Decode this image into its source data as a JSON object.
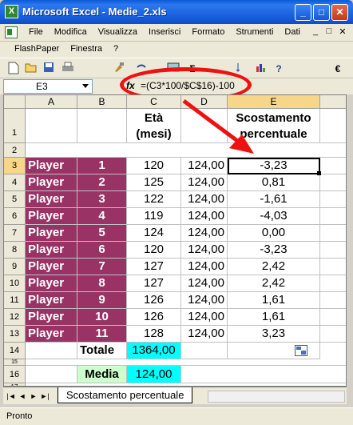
{
  "window": {
    "title": "Microsoft Excel - Medie_2.xls",
    "app_icon_letter": "X",
    "min_glyph": "_",
    "max_glyph": "□",
    "close_glyph": "✕"
  },
  "menu": {
    "items": [
      "File",
      "Modifica",
      "Visualizza",
      "Inserisci",
      "Formato",
      "Strumenti",
      "Dati"
    ],
    "row2": [
      "FlashPaper",
      "Finestra",
      "?"
    ],
    "mdi_min": "_",
    "mdi_restore": "□",
    "mdi_close": "✕"
  },
  "toolbar": {
    "icons": [
      "new-icon",
      "open-icon",
      "save-icon",
      "print-icon",
      "brush-icon",
      "undo-icon",
      "image-icon",
      "sum-icon",
      "sort-icon",
      "chart-icon",
      "help-icon",
      "euro-icon"
    ],
    "sum_glyph": "Σ",
    "help_glyph": "?",
    "euro_glyph": "€"
  },
  "formula_bar": {
    "name_box": "E3",
    "fx_label": "fx",
    "formula": "=(C3*100/$C$16)-100"
  },
  "sheet": {
    "columns": [
      "A",
      "B",
      "C",
      "D",
      "E"
    ],
    "rows": [
      "1",
      "2",
      "3",
      "4",
      "5",
      "6",
      "7",
      "8",
      "9",
      "10",
      "11",
      "12",
      "13",
      "14",
      "15",
      "16",
      "17"
    ],
    "header_eta": "Età (mesi)",
    "header_scost": "Scostamento percentuale",
    "players": [
      {
        "name": "Player",
        "num": "1",
        "eta": "120",
        "media": "124,00",
        "scost": "-3,23"
      },
      {
        "name": "Player",
        "num": "2",
        "eta": "125",
        "media": "124,00",
        "scost": "0,81"
      },
      {
        "name": "Player",
        "num": "3",
        "eta": "122",
        "media": "124,00",
        "scost": "-1,61"
      },
      {
        "name": "Player",
        "num": "4",
        "eta": "119",
        "media": "124,00",
        "scost": "-4,03"
      },
      {
        "name": "Player",
        "num": "5",
        "eta": "124",
        "media": "124,00",
        "scost": "0,00"
      },
      {
        "name": "Player",
        "num": "6",
        "eta": "120",
        "media": "124,00",
        "scost": "-3,23"
      },
      {
        "name": "Player",
        "num": "7",
        "eta": "127",
        "media": "124,00",
        "scost": "2,42"
      },
      {
        "name": "Player",
        "num": "8",
        "eta": "127",
        "media": "124,00",
        "scost": "2,42"
      },
      {
        "name": "Player",
        "num": "9",
        "eta": "126",
        "media": "124,00",
        "scost": "1,61"
      },
      {
        "name": "Player",
        "num": "10",
        "eta": "126",
        "media": "124,00",
        "scost": "1,61"
      },
      {
        "name": "Player",
        "num": "11",
        "eta": "128",
        "media": "124,00",
        "scost": "3,23"
      }
    ],
    "totale_label": "Totale",
    "totale_value": "1364,00",
    "media_label": "Media",
    "media_value": "124,00"
  },
  "tabs": {
    "active": "Scostamento percentuale",
    "nav": [
      "|◄",
      "◄",
      "►",
      "►|"
    ]
  },
  "status": {
    "text": "Pronto"
  },
  "colors": {
    "maroon": "#993366",
    "cyan": "#00ffff",
    "light_green": "#ccffcc",
    "annotation_red": "#ee1111",
    "title_blue": "#1b63e0"
  }
}
